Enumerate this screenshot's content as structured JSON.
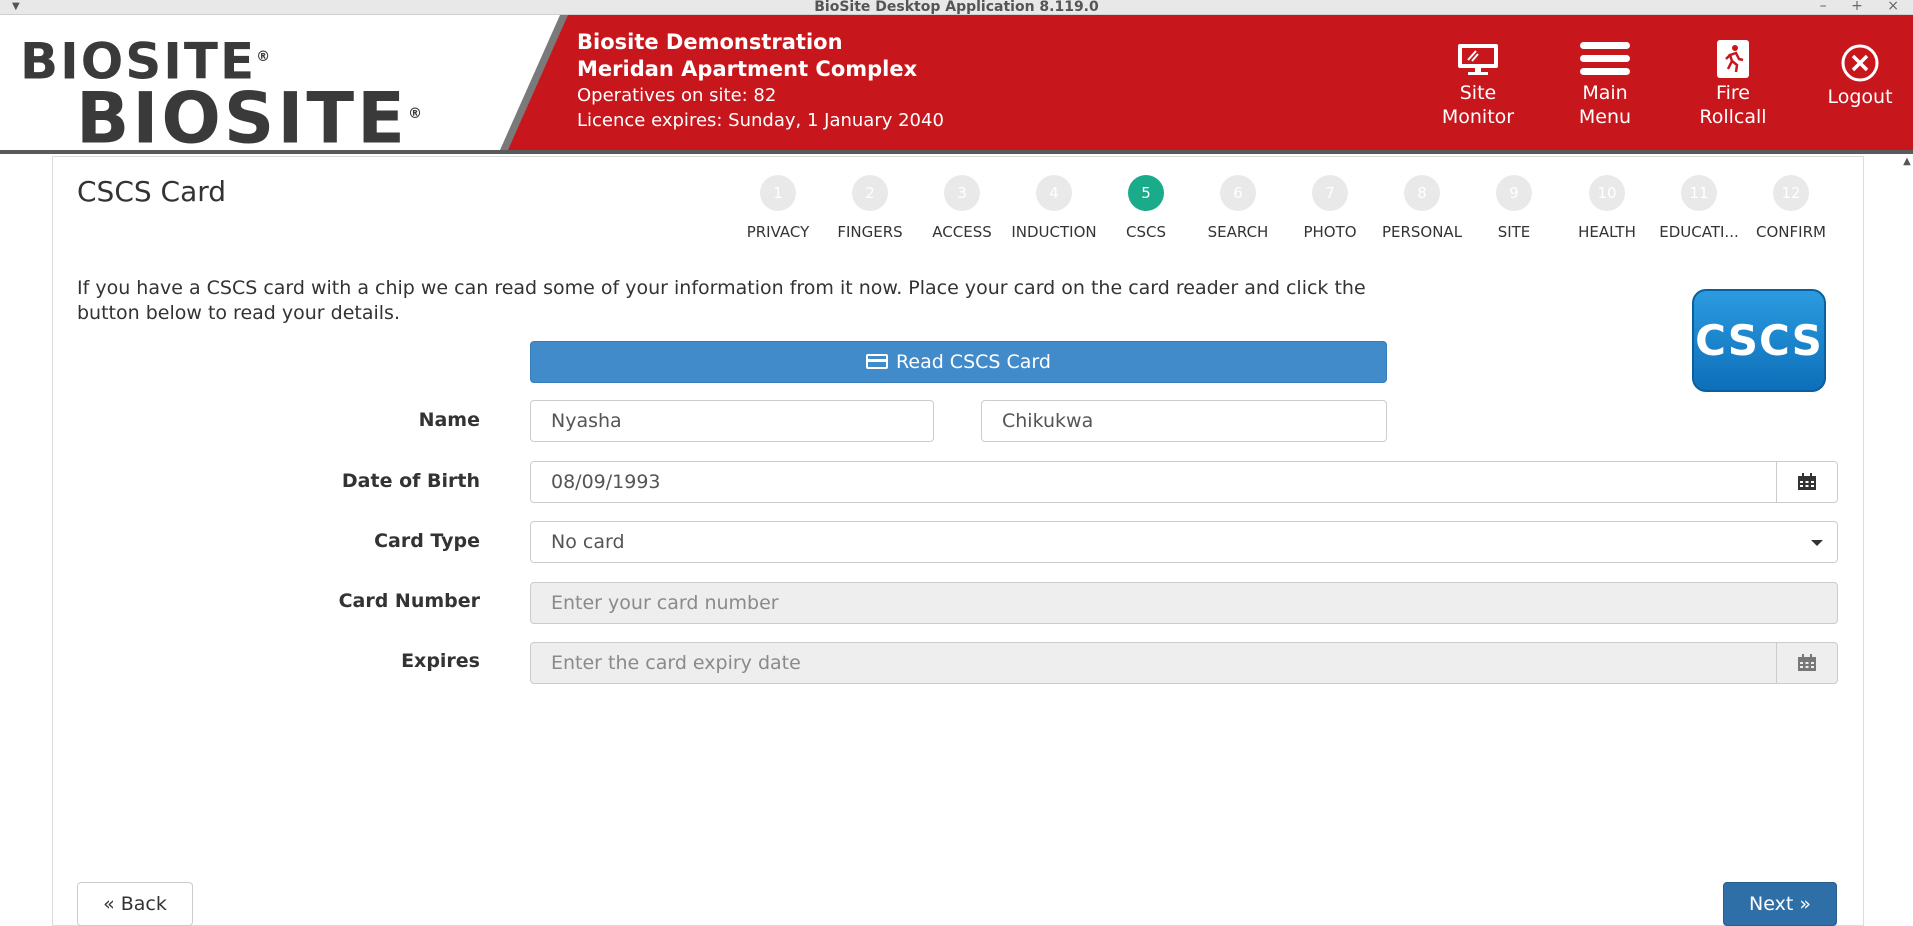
{
  "window": {
    "title": "BioSite Desktop Application 8.119.0",
    "controls": "– + ×"
  },
  "header": {
    "logo_top": "BIOSITE",
    "logo_bottom": "BIOSITE",
    "logo_mark": "®",
    "company": "Biosite Demonstration",
    "site": "Meridan Apartment Complex",
    "operatives": "Operatives on site: 82",
    "licence": "Licence expires: Sunday, 1 January 2040",
    "buttons": {
      "site_monitor": [
        "Site",
        "Monitor"
      ],
      "main_menu": [
        "Main",
        "Menu"
      ],
      "fire_rollcall": [
        "Fire",
        "Rollcall"
      ],
      "logout": "Logout"
    },
    "colors": {
      "brand_red": "#c8161d"
    }
  },
  "page": {
    "title": "CSCS Card",
    "steps": [
      {
        "num": "1",
        "label": "PRIVACY"
      },
      {
        "num": "2",
        "label": "FINGERS"
      },
      {
        "num": "3",
        "label": "ACCESS"
      },
      {
        "num": "4",
        "label": "INDUCTION"
      },
      {
        "num": "5",
        "label": "CSCS",
        "active": true
      },
      {
        "num": "6",
        "label": "SEARCH"
      },
      {
        "num": "7",
        "label": "PHOTO"
      },
      {
        "num": "8",
        "label": "PERSONAL"
      },
      {
        "num": "9",
        "label": "SITE"
      },
      {
        "num": "10",
        "label": "HEALTH"
      },
      {
        "num": "11",
        "label": "EDUCATI..."
      },
      {
        "num": "12",
        "label": "CONFIRM"
      }
    ],
    "intro_line1": "If you have a CSCS card with a chip we can read some of your information from it now. Place your card on the card reader and click the",
    "intro_line2": "button below to read your details.",
    "cscs_logo": "CSCS",
    "read_button": "Read CSCS Card",
    "form": {
      "name_label": "Name",
      "first_name": "Nyasha",
      "last_name": "Chikukwa",
      "dob_label": "Date of Birth",
      "dob": "08/09/1993",
      "card_type_label": "Card Type",
      "card_type": "No card",
      "card_number_label": "Card Number",
      "card_number_placeholder": "Enter your card number",
      "expires_label": "Expires",
      "expires_placeholder": "Enter the card expiry date"
    },
    "back_button": "« Back",
    "next_button": "Next »",
    "colors": {
      "active_step": "#1aab8a",
      "primary_button": "#428bca"
    }
  }
}
